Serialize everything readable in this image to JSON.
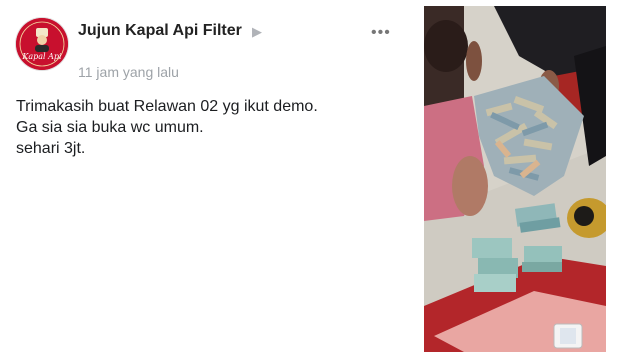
{
  "post": {
    "author": "Jujun Kapal Api Filter",
    "avatar_text": "Kapal Api",
    "timestamp": "11 jam yang lalu",
    "caret_icon": "play-triangle-icon",
    "more_icon": "more-options-icon",
    "body_lines": [
      "Trimakasih buat Relawan 02 yg ikut demo.",
      "Ga sia sia buka wc umum.",
      "sehari 3jt."
    ]
  },
  "photo": {
    "subject": "money-on-floor-photo"
  },
  "colors": {
    "avatar_bg": "#c8102e",
    "timestamp": "#9ea3a8",
    "author": "#222222"
  }
}
